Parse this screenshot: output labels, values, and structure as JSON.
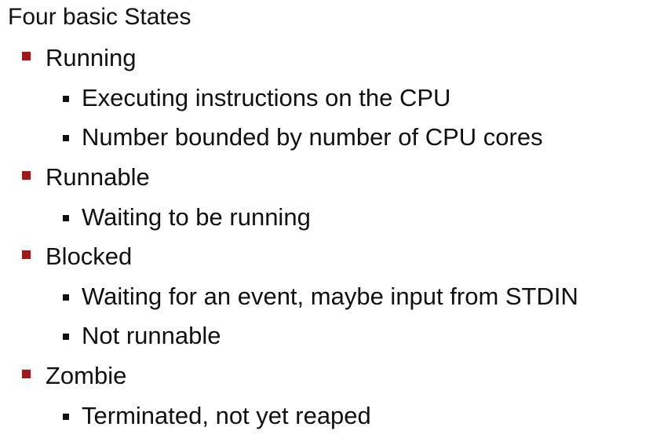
{
  "title": "Four basic States",
  "states": [
    {
      "label": "Running",
      "details": [
        "Executing instructions on the CPU",
        "Number bounded by number of CPU cores"
      ]
    },
    {
      "label": "Runnable",
      "details": [
        "Waiting to be running"
      ]
    },
    {
      "label": "Blocked",
      "details": [
        "Waiting for an event, maybe input from STDIN",
        "Not runnable"
      ]
    },
    {
      "label": "Zombie",
      "details": [
        "Terminated, not yet reaped"
      ]
    }
  ],
  "colors": {
    "level1_bullet": "#a01818",
    "level2_bullet": "#111111",
    "text": "#111111",
    "background": "#ffffff"
  }
}
